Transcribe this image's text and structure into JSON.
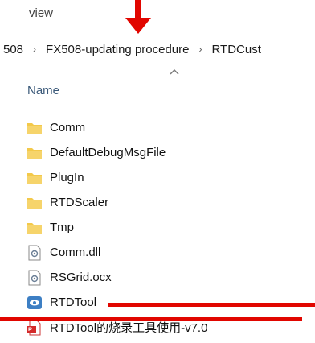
{
  "toolbar": {
    "view_label": "view"
  },
  "breadcrumb": {
    "items": [
      "508",
      "FX508-updating procedure",
      "RTDCust"
    ],
    "separator": "›"
  },
  "column_header": {
    "name_label": "Name"
  },
  "files": [
    {
      "name": "Comm",
      "type": "folder",
      "icon": "folder-icon"
    },
    {
      "name": "DefaultDebugMsgFile",
      "type": "folder",
      "icon": "folder-icon"
    },
    {
      "name": "PlugIn",
      "type": "folder",
      "icon": "folder-icon"
    },
    {
      "name": "RTDScaler",
      "type": "folder",
      "icon": "folder-icon"
    },
    {
      "name": "Tmp",
      "type": "folder",
      "icon": "folder-icon"
    },
    {
      "name": "Comm.dll",
      "type": "dll",
      "icon": "dll-file-icon"
    },
    {
      "name": "RSGrid.ocx",
      "type": "ocx",
      "icon": "ocx-file-icon"
    },
    {
      "name": "RTDTool",
      "type": "application",
      "icon": "application-icon"
    },
    {
      "name": "RTDTool的烧录工具使用-v7.0",
      "type": "pdf",
      "icon": "pdf-file-icon"
    }
  ],
  "colors": {
    "annotation_red": "#e10600",
    "folder_yellow": "#f3c94a",
    "header_text": "#3c5a7a"
  }
}
